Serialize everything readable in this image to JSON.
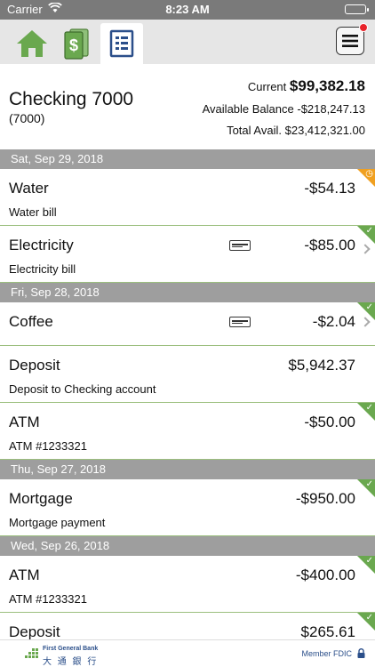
{
  "status": {
    "carrier": "Carrier",
    "time": "8:23 AM"
  },
  "nav": {
    "tabs": [
      {
        "icon": "home-icon"
      },
      {
        "icon": "bill-pay-icon"
      },
      {
        "icon": "statement-icon"
      }
    ],
    "menu_icon": "hamburger-menu-icon",
    "notification": true
  },
  "account": {
    "name": "Checking 7000",
    "number": "(7000)",
    "current_label": "Current",
    "current_value": "$99,382.18",
    "available_label": "Available Balance",
    "available_value": "-$218,247.13",
    "total_label": "Total Avail.",
    "total_value": "$23,412,321.00"
  },
  "groups": [
    {
      "date": "Sat, Sep 29, 2018",
      "txns": [
        {
          "title": "Water",
          "sub": "Water bill",
          "amount": "-$54.13",
          "status": "pending"
        },
        {
          "title": "Electricity",
          "sub": "Electricity bill",
          "amount": "-$85.00",
          "status": "cleared",
          "card": true,
          "chevron": true
        }
      ]
    },
    {
      "date": "Fri, Sep 28, 2018",
      "txns": [
        {
          "title": "Coffee",
          "sub": "",
          "amount": "-$2.04",
          "status": "cleared",
          "card": true,
          "chevron": true
        },
        {
          "title": "Deposit",
          "sub": "Deposit to Checking account",
          "amount": "$5,942.37",
          "status": "none"
        },
        {
          "title": "ATM",
          "sub": "ATM #1233321",
          "amount": "-$50.00",
          "status": "cleared"
        }
      ]
    },
    {
      "date": "Thu, Sep 27, 2018",
      "txns": [
        {
          "title": "Mortgage",
          "sub": "Mortgage payment",
          "amount": "-$950.00",
          "status": "cleared"
        }
      ]
    },
    {
      "date": "Wed, Sep 26, 2018",
      "txns": [
        {
          "title": "ATM",
          "sub": "ATM #1233321",
          "amount": "-$400.00",
          "status": "cleared"
        },
        {
          "title": "Deposit",
          "sub": "",
          "amount": "$265.61",
          "status": "cleared"
        }
      ]
    }
  ],
  "footer": {
    "bank_en": "First General Bank",
    "bank_zh": "大 通 銀 行",
    "fdic": "Member FDIC"
  },
  "colors": {
    "cleared": "#6aa84f",
    "pending": "#f0a020",
    "date_header": "#9e9e9e",
    "brand": "#2b4f8a"
  }
}
